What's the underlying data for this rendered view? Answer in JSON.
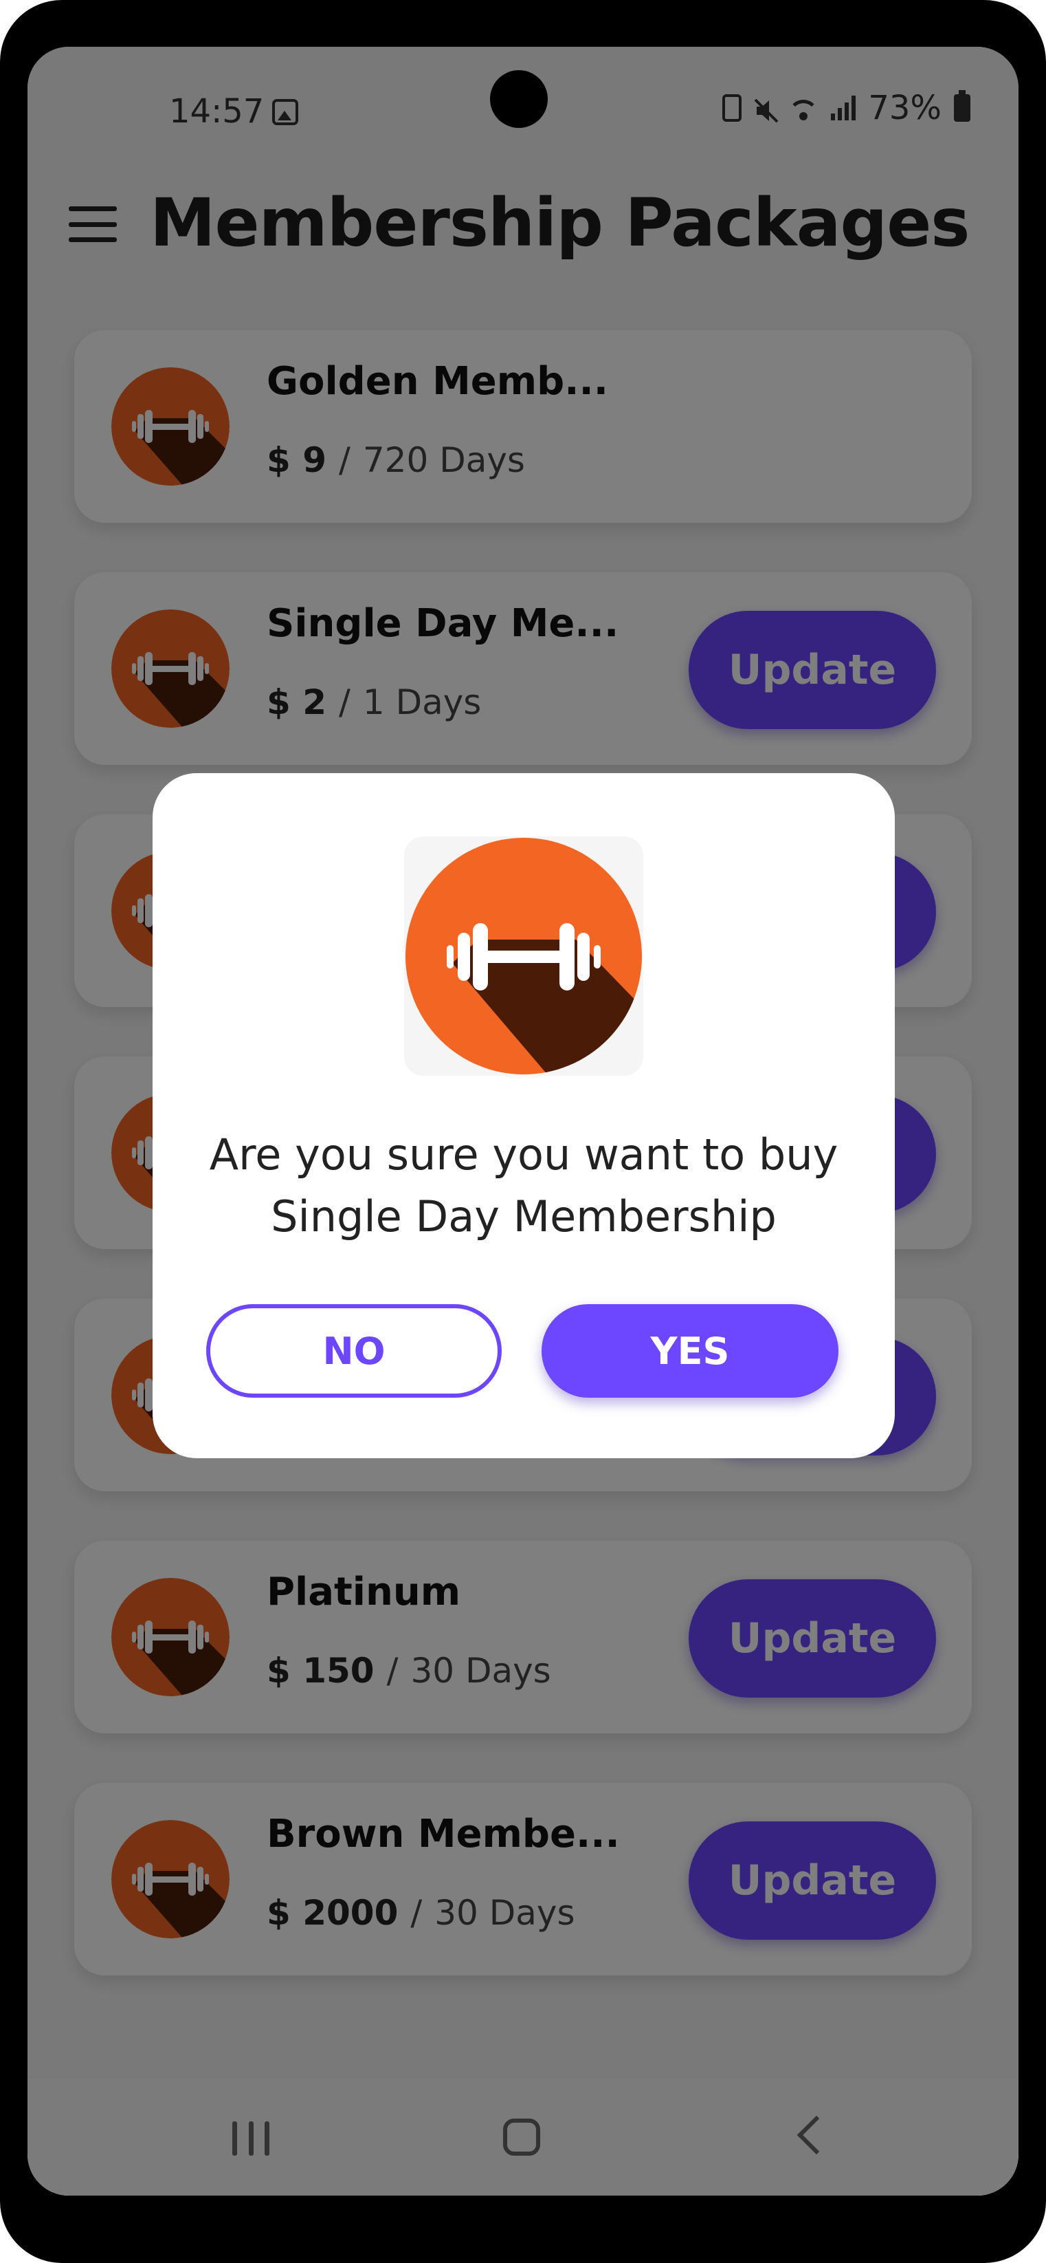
{
  "status_bar": {
    "time": "14:57",
    "battery": "73%"
  },
  "header": {
    "title": "Membership Packages"
  },
  "packages": [
    {
      "name": "Golden Memb...",
      "price": "$ 9",
      "duration": "720 Days",
      "has_update": false
    },
    {
      "name": "Single Day Me...",
      "price": "$ 2",
      "duration": "1 Days",
      "has_update": true
    },
    {
      "name": "",
      "price": "",
      "duration": "",
      "has_update": true
    },
    {
      "name": "",
      "price": "",
      "duration": "",
      "has_update": true
    },
    {
      "name": "",
      "price": "",
      "duration": "",
      "has_update": true
    },
    {
      "name": "Platinum",
      "price": "$ 150",
      "duration": "30 Days",
      "has_update": true
    },
    {
      "name": "Brown Membe...",
      "price": "$ 2000",
      "duration": "30 Days",
      "has_update": true
    }
  ],
  "update_label": "Update",
  "price_separator": "/",
  "dialog": {
    "message_line1": "Are you sure you want to buy",
    "message_line2": "Single Day Membership",
    "no_label": "NO",
    "yes_label": "YES"
  },
  "colors": {
    "accent": "#6c47ff",
    "icon_orange": "#f26522",
    "icon_shadow": "#4a1c08"
  },
  "icons": [
    "menu-icon",
    "dumbbell-icon",
    "gallery-icon",
    "mute-icon",
    "wifi-icon",
    "signal-icon",
    "battery-icon",
    "nav-recent-icon",
    "nav-home-icon",
    "nav-back-icon"
  ]
}
